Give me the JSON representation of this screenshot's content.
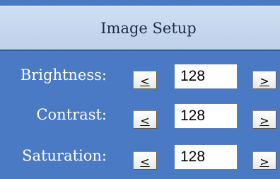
{
  "header": {
    "title": "Image Setup"
  },
  "settings": [
    {
      "label": "Brightness:",
      "value": "128",
      "decrement_label": "<",
      "increment_label": ">"
    },
    {
      "label": "Contrast:",
      "value": "128",
      "decrement_label": "<",
      "increment_label": ">"
    },
    {
      "label": "Saturation:",
      "value": "128",
      "decrement_label": "<",
      "increment_label": ">"
    }
  ],
  "colors": {
    "panel_background": "#4a7ac4",
    "header_background": "#c6d8ee",
    "label_text": "#ffffff"
  }
}
